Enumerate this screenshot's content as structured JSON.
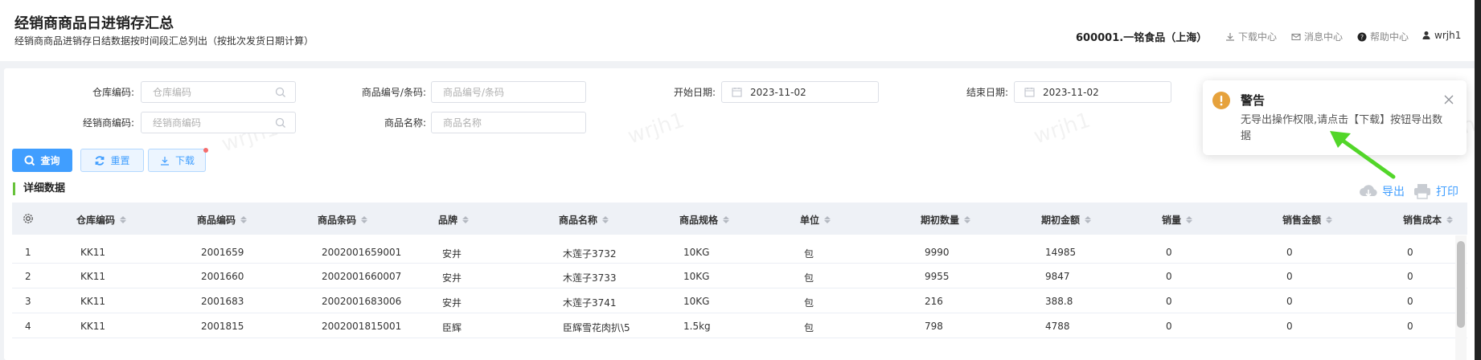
{
  "header": {
    "title": "经销商商品日进销存汇总",
    "subtitle": "经销商商品进销存日结数据按时间段汇总列出（按批次发货日期计算）",
    "company": "600001.一铭食品（上海）",
    "links": {
      "download": "下载中心",
      "messages": "消息中心",
      "help": "帮助中心",
      "user": "wrjh1"
    }
  },
  "filters": {
    "warehouse_label": "仓库编码:",
    "warehouse_placeholder": "仓库编码",
    "dealer_label": "经销商编码:",
    "dealer_placeholder": "经销商编码",
    "product_code_label": "商品编号/条码:",
    "product_code_placeholder": "商品编号/条码",
    "product_name_label": "商品名称:",
    "product_name_placeholder": "商品名称",
    "start_label": "开始日期:",
    "start_value": "2023-11-02",
    "end_label": "结束日期:",
    "end_value": "2023-11-02"
  },
  "buttons": {
    "query": "查询",
    "reset": "重置",
    "download": "下载"
  },
  "section": {
    "title": "详细数据",
    "export": "导出",
    "print": "打印"
  },
  "table": {
    "columns": [
      "仓库编码",
      "商品编码",
      "商品条码",
      "品牌",
      "商品名称",
      "商品规格",
      "单位",
      "期初数量",
      "期初金额",
      "销量",
      "销售金额",
      "销售成本"
    ],
    "rows": [
      {
        "idx": "1",
        "cells": [
          "KK11",
          "2001659",
          "2002001659001",
          "安井",
          "木莲子3732",
          "10KG",
          "包",
          "9990",
          "14985",
          "0",
          "0",
          "0"
        ]
      },
      {
        "idx": "2",
        "cells": [
          "KK11",
          "2001660",
          "2002001660007",
          "安井",
          "木莲子3733",
          "10KG",
          "包",
          "9955",
          "9847",
          "0",
          "0",
          "0"
        ]
      },
      {
        "idx": "3",
        "cells": [
          "KK11",
          "2001683",
          "2002001683006",
          "安井",
          "木莲子3741",
          "10KG",
          "包",
          "216",
          "388.8",
          "0",
          "0",
          "0"
        ]
      },
      {
        "idx": "4",
        "cells": [
          "KK11",
          "2001815",
          "2002001815001",
          "臣辉",
          "臣辉雪花肉扒\\5",
          "1.5kg",
          "包",
          "798",
          "4788",
          "0",
          "0",
          "0"
        ]
      }
    ]
  },
  "watermark": "wrjh1",
  "notification": {
    "title": "警告",
    "message": "无导出操作权限,请点击【下载】按钮导出数据"
  },
  "colors": {
    "primary": "#409eff",
    "accent_green": "#67c23a",
    "warning": "#e6a23c",
    "arrow": "#52d629"
  }
}
